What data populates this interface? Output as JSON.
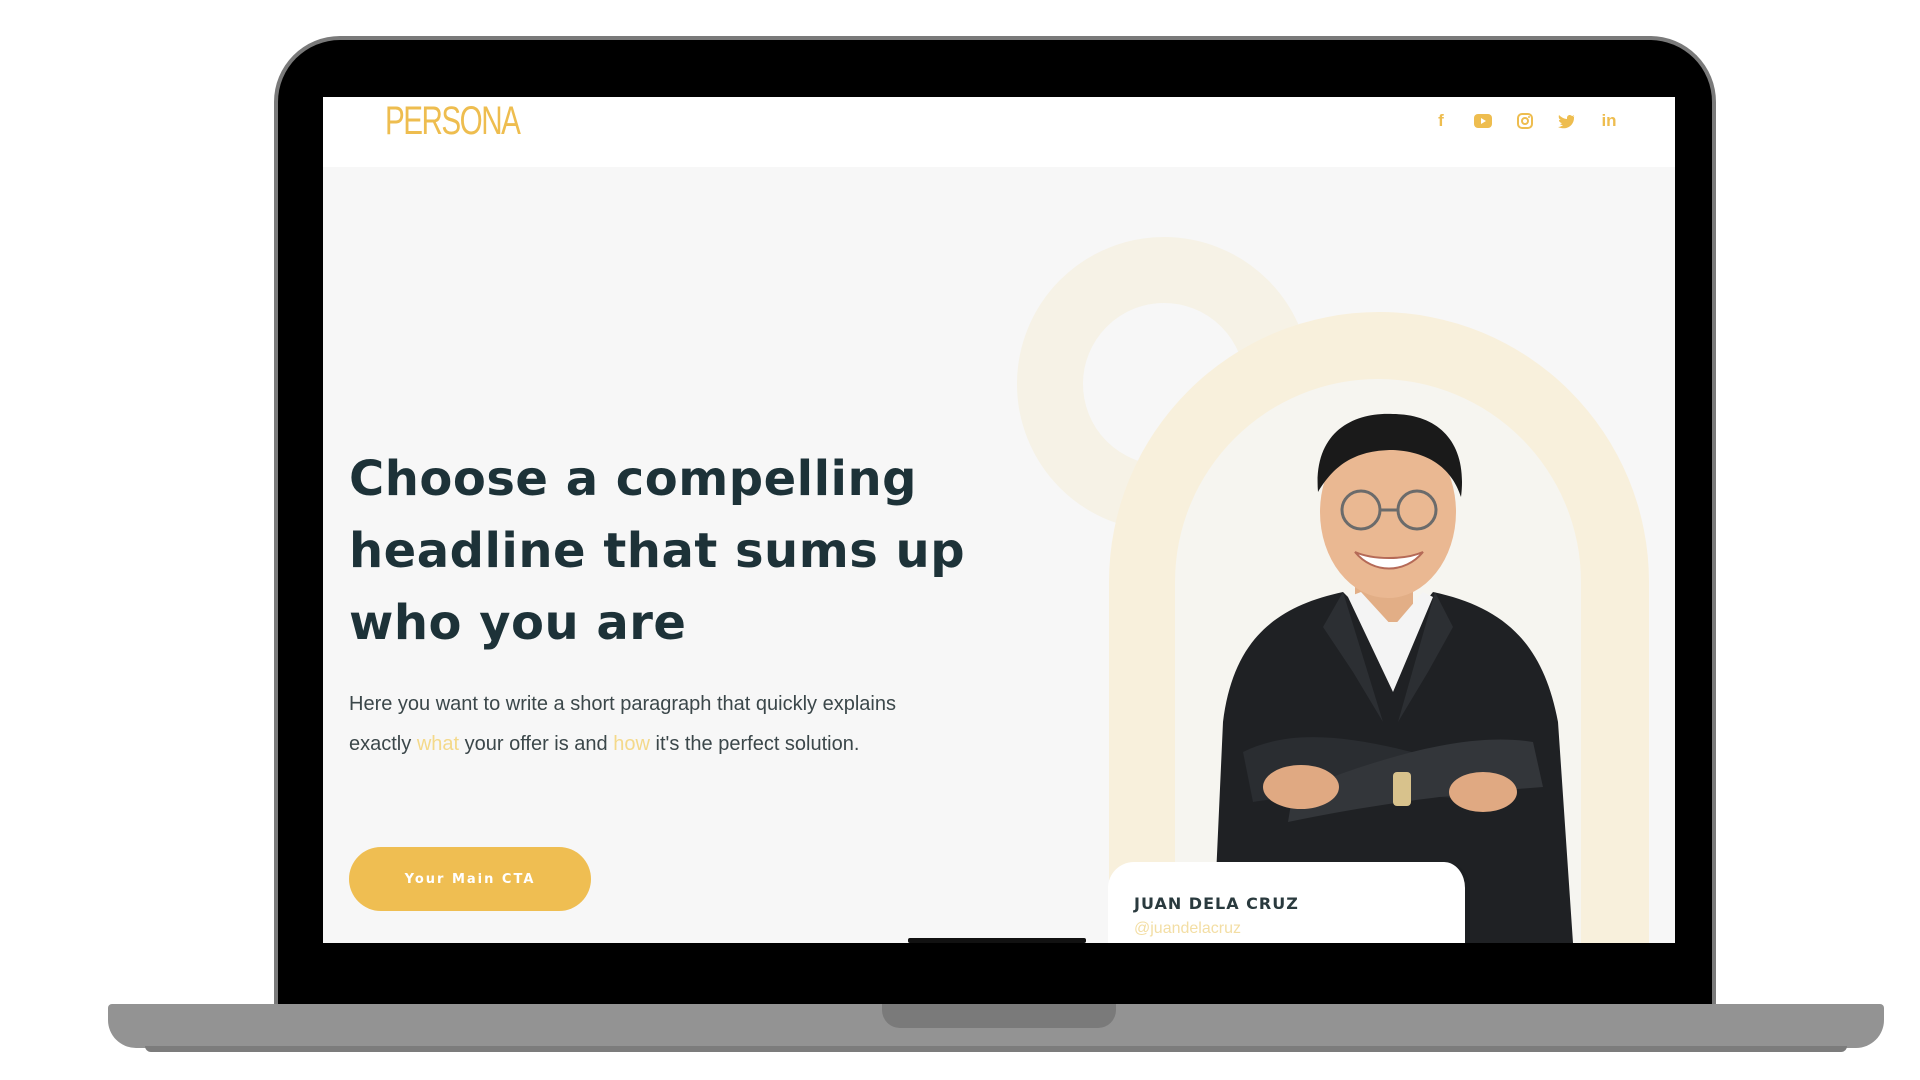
{
  "brand": {
    "logo_text": "PERSONA",
    "accent_color": "#eebd4f",
    "text_color": "#1d3238"
  },
  "social_icons": [
    {
      "icon": "facebook-icon",
      "glyph": "f"
    },
    {
      "icon": "youtube-icon"
    },
    {
      "icon": "instagram-icon"
    },
    {
      "icon": "twitter-icon"
    },
    {
      "icon": "linkedin-icon",
      "glyph": "in"
    }
  ],
  "hero": {
    "headline": "Choose a compelling headline that sums up who you are",
    "paragraph": {
      "part1": "Here you want to write a short paragraph that quickly explains exactly ",
      "highlight1": "what",
      "part2": " your offer is and ",
      "highlight2": "how",
      "part3": " it's the perfect solution."
    },
    "cta_label": "Your Main CTA"
  },
  "profile_card": {
    "name": "JUAN DELA CRUZ",
    "handle": "@juandelacruz"
  }
}
